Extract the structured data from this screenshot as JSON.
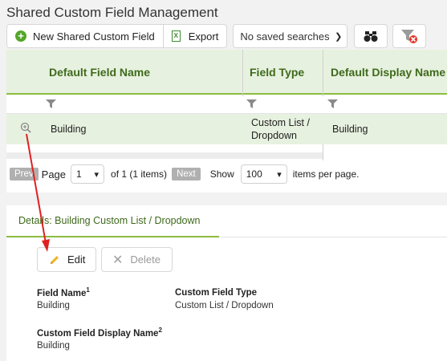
{
  "page": {
    "title": "Shared Custom Field Management"
  },
  "toolbar": {
    "new_label": "New Shared Custom Field",
    "export_label": "Export",
    "saved_searches_value": "No saved searches",
    "find_icon": "binoculars-icon",
    "clear_filter_icon": "clear-filter-icon"
  },
  "grid": {
    "columns": [
      "Default Field Name",
      "Field Type",
      "Default Display Name"
    ],
    "rows": [
      {
        "name": "Building",
        "type": "Custom List / Dropdown",
        "display": "Building"
      }
    ]
  },
  "pager": {
    "prev_label": "Prev",
    "page_label": "Page",
    "page_value": "1",
    "of_text": "of 1 (1 items)",
    "next_label": "Next",
    "show_label": "Show",
    "per_page_value": "100",
    "per_page_text": "items per page."
  },
  "details": {
    "tab_label": "Details: Building Custom List / Dropdown",
    "edit_label": "Edit",
    "delete_label": "Delete",
    "field_name_label": "Field Name",
    "field_name_sup": "1",
    "field_name_value": "Building",
    "field_type_label": "Custom Field Type",
    "field_type_value": "Custom List / Dropdown",
    "display_name_label": "Custom Field Display Name",
    "display_name_sup": "2",
    "display_name_value": "Building"
  },
  "colors": {
    "accent_green": "#8cbd3f",
    "header_text": "#3f6a1c",
    "row_highlight": "#e7f1df",
    "annotation_arrow": "#e02020"
  }
}
